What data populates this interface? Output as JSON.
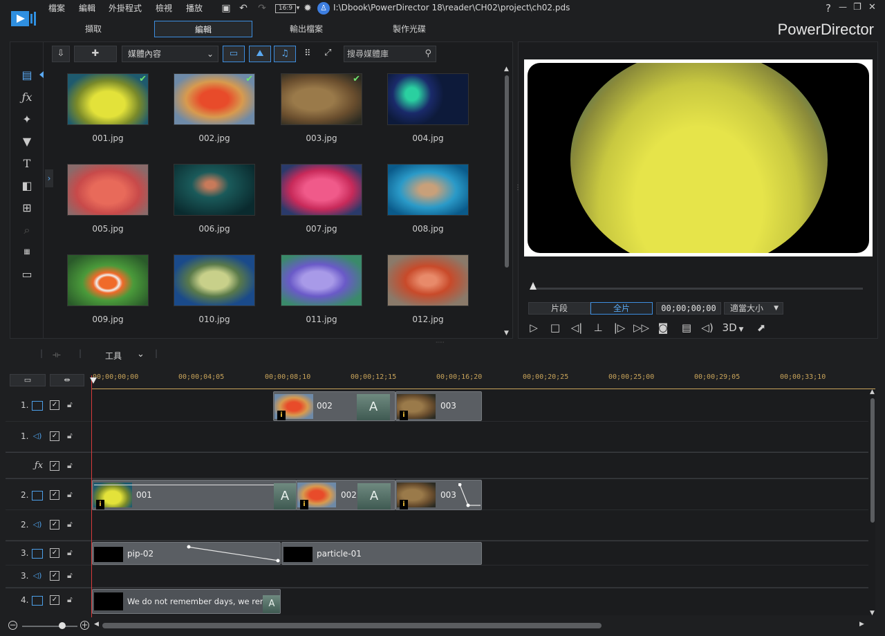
{
  "menu": {
    "items": [
      "檔案",
      "編輯",
      "外掛程式",
      "檢視",
      "播放"
    ],
    "aspect": "16:9",
    "project_path": "I:\\Dbook\\PowerDirector 18\\reader\\CH02\\project\\ch02.pds"
  },
  "window": {
    "help": "?",
    "minimize": "—",
    "restore": "❐",
    "close": "✕"
  },
  "modes": {
    "tabs": [
      "擷取",
      "編輯",
      "輸出檔案",
      "製作光碟"
    ],
    "active": "編輯",
    "brand": "PowerDirector"
  },
  "library": {
    "dropdown": "媒體內容",
    "search_placeholder": "搜尋媒體庫",
    "items": [
      {
        "name": "001.jpg",
        "checked": true
      },
      {
        "name": "002.jpg",
        "checked": true
      },
      {
        "name": "003.jpg",
        "checked": true
      },
      {
        "name": "004.jpg",
        "checked": false
      },
      {
        "name": "005.jpg",
        "checked": false
      },
      {
        "name": "006.jpg",
        "checked": false
      },
      {
        "name": "007.jpg",
        "checked": false
      },
      {
        "name": "008.jpg",
        "checked": false
      },
      {
        "name": "009.jpg",
        "checked": false
      },
      {
        "name": "010.jpg",
        "checked": false
      },
      {
        "name": "011.jpg",
        "checked": false
      },
      {
        "name": "012.jpg",
        "checked": false
      }
    ]
  },
  "preview": {
    "clip_mode": "片段",
    "movie_mode": "全片",
    "timecode": "00;00;00;00",
    "fit": "適當大小",
    "three_d": "3D"
  },
  "timeline": {
    "tools_label": "工具",
    "ruler": [
      "00;00;00;00",
      "00;00;04;05",
      "00;00;08;10",
      "00;00;12;15",
      "00;00;16;20",
      "00;00;20;25",
      "00;00;25;00",
      "00;00;29;05",
      "00;00;33;10"
    ],
    "tracks": [
      {
        "num": "1.",
        "type": "video"
      },
      {
        "num": "1.",
        "type": "audio"
      },
      {
        "num": "",
        "type": "fx"
      },
      {
        "num": "2.",
        "type": "video"
      },
      {
        "num": "2.",
        "type": "audio"
      },
      {
        "num": "3.",
        "type": "video"
      },
      {
        "num": "3.",
        "type": "audio"
      },
      {
        "num": "4.",
        "type": "video"
      }
    ],
    "clips": {
      "t1_a": "002",
      "t1_b": "003",
      "t2_a": "001",
      "t2_b": "002",
      "t2_c": "003",
      "t3_a": "pip-02",
      "t3_b": "particle-01",
      "t4_a": "We do not remember days, we remember moments."
    },
    "transition_glyph": "A",
    "info_glyph": "i"
  }
}
